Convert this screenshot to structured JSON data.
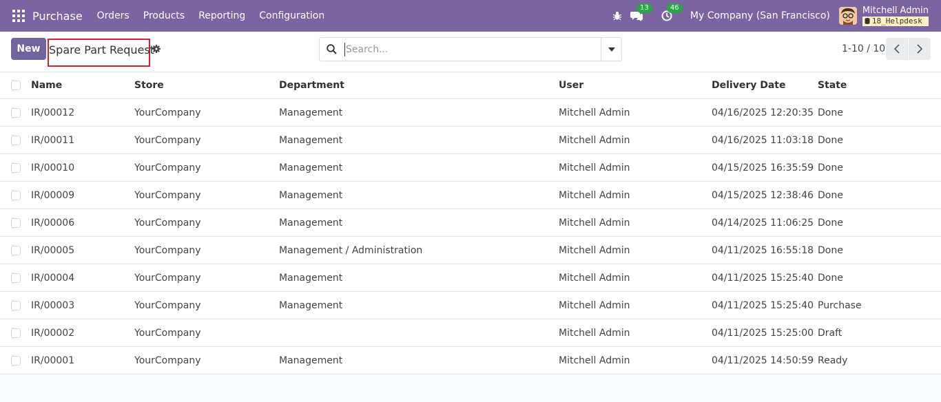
{
  "navbar": {
    "app_name": "Purchase",
    "menu": [
      "Orders",
      "Products",
      "Reporting",
      "Configuration"
    ],
    "messages_count": "13",
    "activities_count": "46",
    "company": "My Company (San Francisco)",
    "user_name": "Mitchell Admin",
    "database": "18_Helpdesk",
    "bar_color": "#7b64a2"
  },
  "control": {
    "new_label": "New",
    "page_title": "Spare Part Request",
    "search_placeholder": "Search...",
    "pager": "1-10 / 10"
  },
  "table": {
    "headers": {
      "name": "Name",
      "store": "Store",
      "department": "Department",
      "user": "User",
      "delivery_date": "Delivery Date",
      "state": "State"
    },
    "rows": [
      {
        "name": "IR/00012",
        "store": "YourCompany",
        "department": "Management",
        "user": "Mitchell Admin",
        "date": "04/16/2025 12:20:35",
        "state": "Done"
      },
      {
        "name": "IR/00011",
        "store": "YourCompany",
        "department": "Management",
        "user": "Mitchell Admin",
        "date": "04/16/2025 11:03:18",
        "state": "Done"
      },
      {
        "name": "IR/00010",
        "store": "YourCompany",
        "department": "Management",
        "user": "Mitchell Admin",
        "date": "04/15/2025 16:35:59",
        "state": "Done"
      },
      {
        "name": "IR/00009",
        "store": "YourCompany",
        "department": "Management",
        "user": "Mitchell Admin",
        "date": "04/15/2025 12:38:46",
        "state": "Done"
      },
      {
        "name": "IR/00006",
        "store": "YourCompany",
        "department": "Management",
        "user": "Mitchell Admin",
        "date": "04/14/2025 11:06:25",
        "state": "Done"
      },
      {
        "name": "IR/00005",
        "store": "YourCompany",
        "department": "Management / Administration",
        "user": "Mitchell Admin",
        "date": "04/11/2025 16:55:18",
        "state": "Done"
      },
      {
        "name": "IR/00004",
        "store": "YourCompany",
        "department": "Management",
        "user": "Mitchell Admin",
        "date": "04/11/2025 15:25:40",
        "state": "Done"
      },
      {
        "name": "IR/00003",
        "store": "YourCompany",
        "department": "Management",
        "user": "Mitchell Admin",
        "date": "04/11/2025 15:25:40",
        "state": "Purchase"
      },
      {
        "name": "IR/00002",
        "store": "YourCompany",
        "department": "",
        "user": "Mitchell Admin",
        "date": "04/11/2025 15:25:00",
        "state": "Draft"
      },
      {
        "name": "IR/00001",
        "store": "YourCompany",
        "department": "Management",
        "user": "Mitchell Admin",
        "date": "04/11/2025 14:50:59",
        "state": "Ready"
      }
    ]
  }
}
